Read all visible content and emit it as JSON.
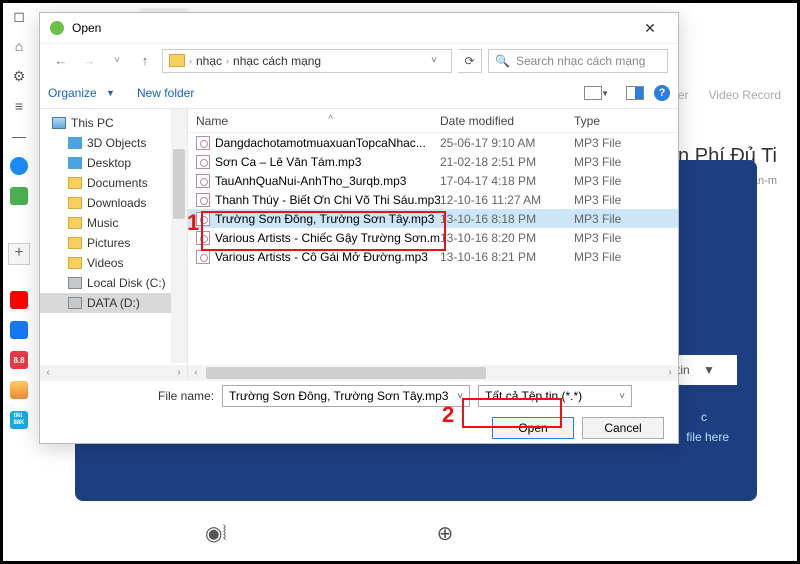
{
  "domain": "Computer-Use",
  "browser": {
    "top_right_links": [
      "Cutter",
      "Video Record"
    ],
    "hero_title": "ễn Phí Đủ Ti",
    "hero_sub": "jian sapo.vn/phần-m",
    "pill_text": "tin",
    "drop_text_partial": "c",
    "drop_text": " file here"
  },
  "dialog": {
    "title": "Open",
    "path": {
      "seg1": "nhạc",
      "seg2": "nhạc cách mạng"
    },
    "search_placeholder": "Search nhạc cách mạng",
    "toolbar": {
      "organize": "Organize",
      "new_folder": "New folder"
    },
    "columns": {
      "name": "Name",
      "date": "Date modified",
      "type": "Type"
    },
    "tree": {
      "this_pc": "This PC",
      "items": [
        "3D Objects",
        "Desktop",
        "Documents",
        "Downloads",
        "Music",
        "Pictures",
        "Videos",
        "Local Disk (C:)",
        "DATA (D:)"
      ]
    },
    "files": [
      {
        "name": "DangdachotamotmuaxuanTopcaNhac...",
        "date": "25-06-17 9:10 AM",
        "type": "MP3 File"
      },
      {
        "name": "Sơn Ca – Lê Văn Tám.mp3",
        "date": "21-02-18 2:51 PM",
        "type": "MP3 File"
      },
      {
        "name": "TauAnhQuaNui-AnhTho_3urqb.mp3",
        "date": "17-04-17 4:18 PM",
        "type": "MP3 File"
      },
      {
        "name": "Thanh Thúy - Biết Ơn Chi Võ Thi Sáu.mp3",
        "date": "12-10-16 11:27 AM",
        "type": "MP3 File"
      },
      {
        "name": "Trường Sơn Đông, Trường Sơn Tây.mp3",
        "date": "13-10-16 8:18 PM",
        "type": "MP3 File"
      },
      {
        "name": "Various Artists - Chiếc Gậy Trường Sơn.m...",
        "date": "13-10-16 8:20 PM",
        "type": "MP3 File"
      },
      {
        "name": "Various Artists - Cô Gái Mở Đường.mp3",
        "date": "13-10-16 8:21 PM",
        "type": "MP3 File"
      }
    ],
    "selected_index": 4,
    "filename_label": "File name:",
    "filename_value": "Trường Sơn Đông, Trường Sơn Tây.mp3",
    "filter_value": "Tất cả Tệp tin (*.*)",
    "open_btn": "Open",
    "cancel_btn": "Cancel"
  },
  "annotation": {
    "one": "1",
    "two": "2"
  }
}
